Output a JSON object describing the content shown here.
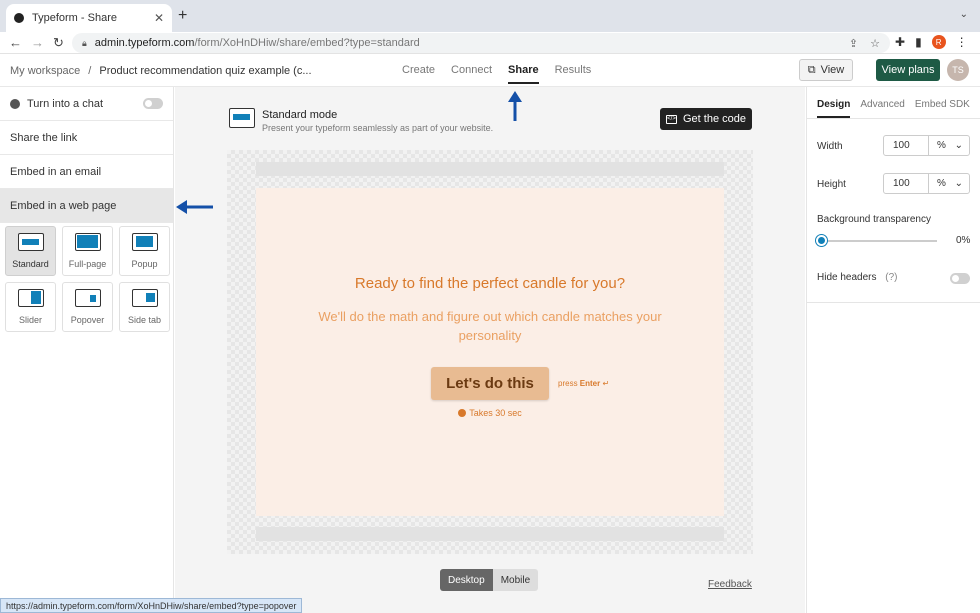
{
  "browser": {
    "tab_title": "Typeform - Share",
    "url_host": "admin.typeform.com",
    "url_path": "/form/XoHnDHiw/share/embed?type=standard",
    "profile_letter": "R",
    "status_url": "https://admin.typeform.com/form/XoHnDHiw/share/embed?type=popover"
  },
  "header": {
    "workspace": "My workspace",
    "separator": "/",
    "form_name": "Product recommendation quiz example (c...",
    "tabs": [
      {
        "label": "Create"
      },
      {
        "label": "Connect"
      },
      {
        "label": "Share"
      },
      {
        "label": "Results"
      }
    ],
    "active_tab": "Share",
    "view_label": "View",
    "plans_label": "View plans",
    "avatar_initials": "TS"
  },
  "sidebar": {
    "chat_label": "Turn into a chat",
    "items": [
      {
        "label": "Share the link"
      },
      {
        "label": "Embed in an email"
      },
      {
        "label": "Embed in a web page"
      }
    ],
    "modes": [
      {
        "label": "Standard",
        "icon": "standard-embed-icon"
      },
      {
        "label": "Full-page",
        "icon": "full-page-embed-icon"
      },
      {
        "label": "Popup",
        "icon": "popup-embed-icon"
      },
      {
        "label": "Slider",
        "icon": "slider-embed-icon"
      },
      {
        "label": "Popover",
        "icon": "popover-embed-icon"
      },
      {
        "label": "Side tab",
        "icon": "side-tab-embed-icon"
      }
    ]
  },
  "main": {
    "mode_title": "Standard mode",
    "mode_desc": "Present your typeform seamlessly as part of your website.",
    "code_label": "Get the code",
    "form": {
      "title": "Ready to find the perfect candle for you?",
      "description": "We'll do the math and figure out which candle matches your personality",
      "button": "Let's do this",
      "press": "press",
      "enter": "Enter",
      "enter_glyph": "↵",
      "takes": "Takes 30 sec"
    },
    "device_tabs": [
      "Desktop",
      "Mobile"
    ],
    "feedback": "Feedback"
  },
  "right_panel": {
    "tabs": [
      "Design",
      "Advanced",
      "Embed SDK"
    ],
    "width_label": "Width",
    "width_value": "100",
    "width_unit": "%",
    "height_label": "Height",
    "height_value": "100",
    "height_unit": "%",
    "transparency_label": "Background transparency",
    "transparency_value": "0%",
    "hide_headers_label": "Hide headers",
    "hide_headers_hint": "(?)"
  },
  "colors": {
    "accent": "#1180b8",
    "primary_button": "#1e5a45",
    "form_text": "#d8792b",
    "form_bg": "#fbeee6",
    "annotation_arrow": "#1450a8"
  }
}
